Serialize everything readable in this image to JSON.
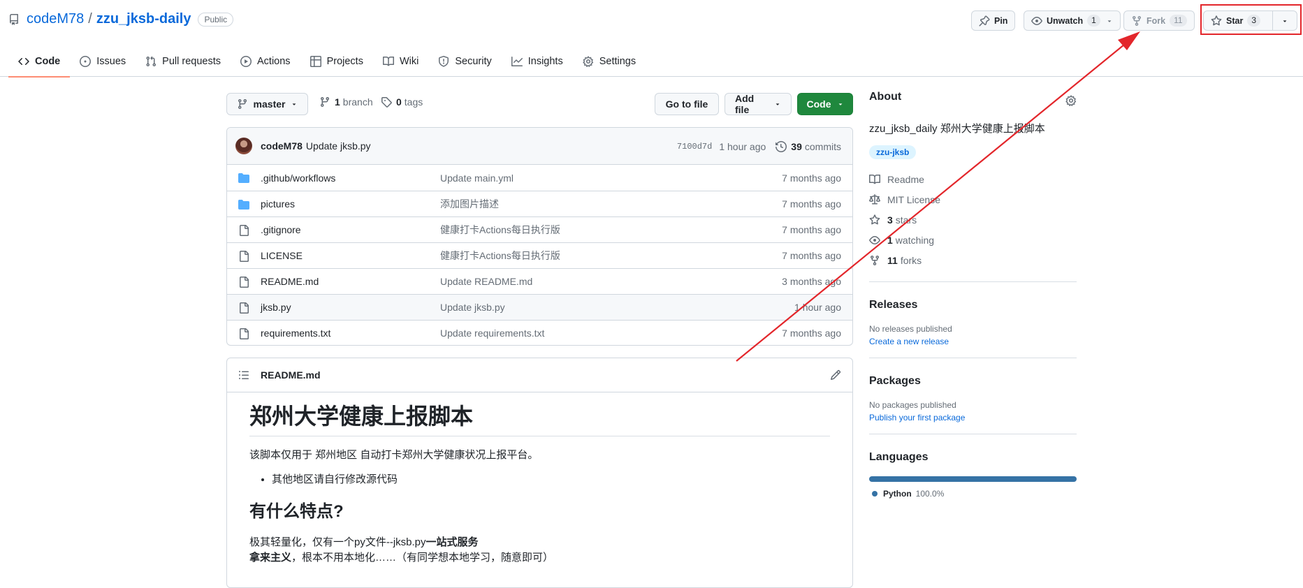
{
  "repo": {
    "owner": "codeM78",
    "separator": "/",
    "name": "zzu_jksb-daily",
    "visibility": "Public"
  },
  "actions": {
    "pin": "Pin",
    "unwatch": "Unwatch",
    "watch_count": "1",
    "fork": "Fork",
    "fork_count": "11",
    "star": "Star",
    "star_count": "3"
  },
  "tabs": [
    {
      "label": "Code"
    },
    {
      "label": "Issues"
    },
    {
      "label": "Pull requests"
    },
    {
      "label": "Actions"
    },
    {
      "label": "Projects"
    },
    {
      "label": "Wiki"
    },
    {
      "label": "Security"
    },
    {
      "label": "Insights"
    },
    {
      "label": "Settings"
    }
  ],
  "toolbar": {
    "branch": "master",
    "branches_count": "1",
    "branches_label": "branch",
    "tags_count": "0",
    "tags_label": "tags",
    "go_to_file": "Go to file",
    "add_file": "Add file",
    "code": "Code"
  },
  "commit": {
    "author": "codeM78",
    "message": "Update jksb.py",
    "hash": "7100d7d",
    "time": "1 hour ago",
    "count": "39",
    "count_label": "commits"
  },
  "files": [
    {
      "type": "dir",
      "name": ".github/workflows",
      "message": "Update main.yml",
      "age": "7 months ago"
    },
    {
      "type": "dir",
      "name": "pictures",
      "message": "添加图片描述",
      "age": "7 months ago"
    },
    {
      "type": "file",
      "name": ".gitignore",
      "message": "健康打卡Actions每日执行版",
      "age": "7 months ago"
    },
    {
      "type": "file",
      "name": "LICENSE",
      "message": "健康打卡Actions每日执行版",
      "age": "7 months ago"
    },
    {
      "type": "file",
      "name": "README.md",
      "message": "Update README.md",
      "age": "3 months ago"
    },
    {
      "type": "file",
      "name": "jksb.py",
      "message": "Update jksb.py",
      "age": "1 hour ago"
    },
    {
      "type": "file",
      "name": "requirements.txt",
      "message": "Update requirements.txt",
      "age": "7 months ago"
    }
  ],
  "readme": {
    "filename": "README.md",
    "h1": "郑州大学健康上报脚本",
    "intro": "该脚本仅用于 郑州地区 自动打卡郑州大学健康状况上报平台。",
    "bullet": "其他地区请自行修改源代码",
    "h2": "有什么特点?",
    "feature_prefix": "极其轻量化，仅有一个py文件--jksb.py",
    "feature_bold": "一站式服务",
    "feature2_bold": "拿来主义",
    "feature2_rest": "，根本不用本地化……（有同学想本地学习，随意即可）"
  },
  "about": {
    "title": "About",
    "description": "zzu_jksb_daily 郑州大学健康上报脚本",
    "topic": "zzu-jksb",
    "readme": "Readme",
    "license": "MIT License",
    "stars_count": "3",
    "stars_label": "stars",
    "watching_count": "1",
    "watching_label": "watching",
    "forks_count": "11",
    "forks_label": "forks"
  },
  "releases": {
    "title": "Releases",
    "empty": "No releases published",
    "link": "Create a new release"
  },
  "packages": {
    "title": "Packages",
    "empty": "No packages published",
    "link": "Publish your first package"
  },
  "languages": {
    "title": "Languages",
    "items": [
      {
        "name": "Python",
        "percent": "100.0%",
        "share": 1.0,
        "color": "#3572a5"
      }
    ]
  },
  "icons": {
    "repo": "repo-icon",
    "pin": "pin-icon",
    "eye": "eye-icon",
    "fork": "repo-forked-icon",
    "star": "star-icon",
    "code": "code-icon",
    "issues": "issue-opened-icon",
    "pulls": "git-pull-request-icon",
    "actions": "play-icon",
    "projects": "table-icon",
    "wiki": "book-icon",
    "security": "shield-icon",
    "insights": "graph-icon",
    "settings": "gear-icon"
  },
  "colors": {
    "link": "#0969da",
    "green_button": "#1f883d",
    "tab_underline": "#fd8c73",
    "annotation_red": "#e3262b",
    "folder": "#54aeff"
  }
}
